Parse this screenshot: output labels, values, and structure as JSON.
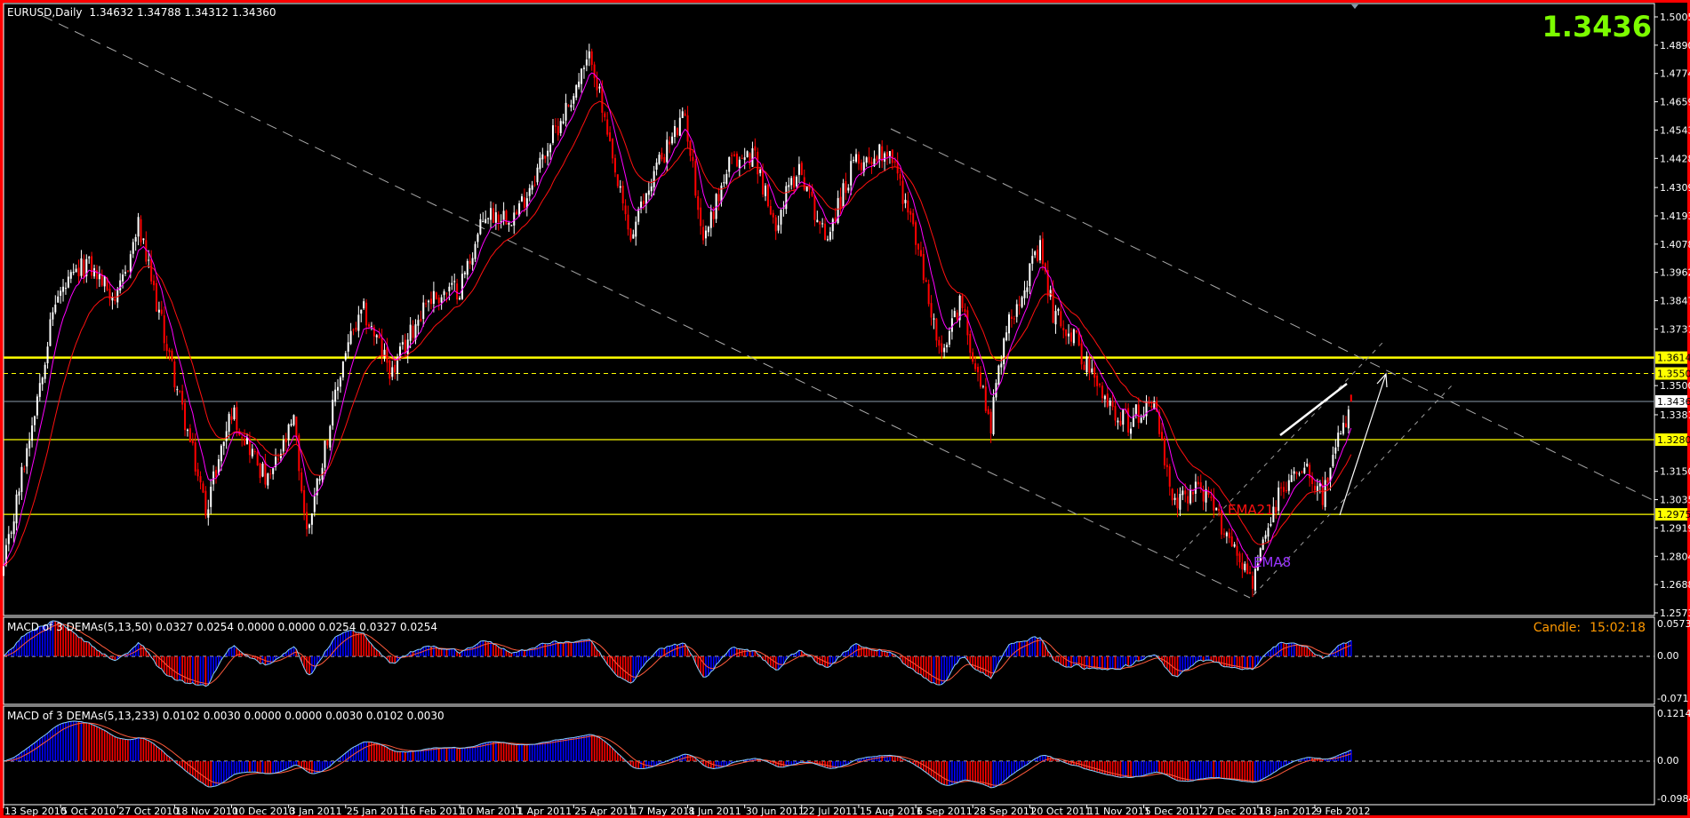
{
  "window": {
    "title": "EURUSD,Daily",
    "ohlc": "1.34632 1.34788 1.34312 1.34360",
    "big_price": "1.3436",
    "candle_timer_label": "Candle:",
    "candle_timer_value": "15:02:18"
  },
  "colors": {
    "frame": "#ff0000",
    "bull": "#ffffff",
    "bear": "#ff0000",
    "ema8": "#ff00ff",
    "ema21": "#ff1010",
    "level": "#ffff00",
    "big_price": "#7cfc00",
    "timer": "#ff9900",
    "hist_up": "#0000ff",
    "hist_down": "#ff0000",
    "macd_line": "#87cefa",
    "signal_line": "#ff5a3c"
  },
  "price_axis": {
    "ticks": [
      "1.50055",
      "1.48900",
      "1.47745",
      "1.46590",
      "1.45435",
      "1.44280",
      "1.43090",
      "1.41935",
      "1.40780",
      "1.39625",
      "1.38470",
      "1.37315",
      "1.35005",
      "1.33815",
      "1.31505",
      "1.30350",
      "1.29195",
      "1.28040",
      "1.26885",
      "1.25730"
    ],
    "highlights": [
      {
        "value": "1.36148",
        "bg": "#ffff00",
        "fg": "#000000"
      },
      {
        "value": "1.35500",
        "bg": "#ffff00",
        "fg": "#000000"
      },
      {
        "value": "1.34360",
        "bg": "#ffffff",
        "fg": "#000000"
      },
      {
        "value": "1.32800",
        "bg": "#ffff00",
        "fg": "#000000"
      },
      {
        "value": "1.29750",
        "bg": "#ffff00",
        "fg": "#000000"
      }
    ]
  },
  "levels": [
    {
      "price": 1.36148,
      "style": "solid-thick"
    },
    {
      "price": 1.355,
      "style": "dashed"
    },
    {
      "price": 1.3436,
      "style": "bid"
    },
    {
      "price": 1.328,
      "style": "solid"
    },
    {
      "price": 1.2975,
      "style": "solid"
    }
  ],
  "annotations": {
    "ema21_label": "EMA21",
    "ema8_label": "EMA8"
  },
  "macd1": {
    "label": "MACD of 3 DEMAs(5,13,50) 0.0327 0.0254 0.0000 0.0000 0.0254 0.0327 0.0254",
    "max": "0.0573",
    "zero": "0.00",
    "min": "-0.071"
  },
  "macd2": {
    "label": "MACD of 3 DEMAs(5,13,233) 0.0102 0.0030 0.0000 0.0000 0.0030 0.0102 0.0030",
    "max": "0.1214",
    "zero": "0.00",
    "min": "-0.0984"
  },
  "time_axis": {
    "bars_per_tick": 22,
    "labels": [
      "13 Sep 2010",
      "5 Oct 2010",
      "27 Oct 2010",
      "18 Nov 2010",
      "10 Dec 2010",
      "3 Jan 2011",
      "25 Jan 2011",
      "16 Feb 2011",
      "10 Mar 2011",
      "1 Apr 2011",
      "25 Apr 2011",
      "17 May 2011",
      "8 Jun 2011",
      "30 Jun 2011",
      "22 Jul 2011",
      "15 Aug 2011",
      "6 Sep 2011",
      "28 Sep 2011",
      "20 Oct 2011",
      "11 Nov 2011",
      "5 Dec 2011",
      "27 Dec 2011",
      "18 Jan 2012",
      "9 Feb 2012"
    ]
  },
  "chart_data": {
    "type": "candlestick",
    "symbol": "EURUSD",
    "timeframe": "Daily",
    "ylim": [
      1.2573,
      1.50055
    ],
    "bars": 521,
    "close_anchors": [
      [
        0,
        1.275
      ],
      [
        20,
        1.385
      ],
      [
        32,
        1.4
      ],
      [
        44,
        1.385
      ],
      [
        52,
        1.415
      ],
      [
        78,
        1.3
      ],
      [
        88,
        1.34
      ],
      [
        102,
        1.31
      ],
      [
        112,
        1.335
      ],
      [
        117,
        1.29
      ],
      [
        132,
        1.365
      ],
      [
        139,
        1.38
      ],
      [
        150,
        1.355
      ],
      [
        163,
        1.385
      ],
      [
        176,
        1.39
      ],
      [
        186,
        1.42
      ],
      [
        198,
        1.42
      ],
      [
        211,
        1.45
      ],
      [
        227,
        1.485
      ],
      [
        235,
        1.44
      ],
      [
        242,
        1.41
      ],
      [
        252,
        1.44
      ],
      [
        263,
        1.46
      ],
      [
        270,
        1.41
      ],
      [
        280,
        1.44
      ],
      [
        290,
        1.445
      ],
      [
        297,
        1.415
      ],
      [
        307,
        1.44
      ],
      [
        317,
        1.41
      ],
      [
        328,
        1.44
      ],
      [
        342,
        1.447
      ],
      [
        352,
        1.41
      ],
      [
        362,
        1.36
      ],
      [
        369,
        1.385
      ],
      [
        376,
        1.355
      ],
      [
        381,
        1.335
      ],
      [
        386,
        1.37
      ],
      [
        393,
        1.39
      ],
      [
        400,
        1.405
      ],
      [
        405,
        1.38
      ],
      [
        413,
        1.37
      ],
      [
        424,
        1.345
      ],
      [
        434,
        1.335
      ],
      [
        444,
        1.345
      ],
      [
        451,
        1.3
      ],
      [
        461,
        1.31
      ],
      [
        472,
        1.29
      ],
      [
        482,
        1.27
      ],
      [
        492,
        1.305
      ],
      [
        502,
        1.32
      ],
      [
        509,
        1.305
      ],
      [
        516,
        1.33
      ],
      [
        520,
        1.3436
      ]
    ],
    "indicators": [
      "EMA8",
      "EMA21"
    ]
  }
}
